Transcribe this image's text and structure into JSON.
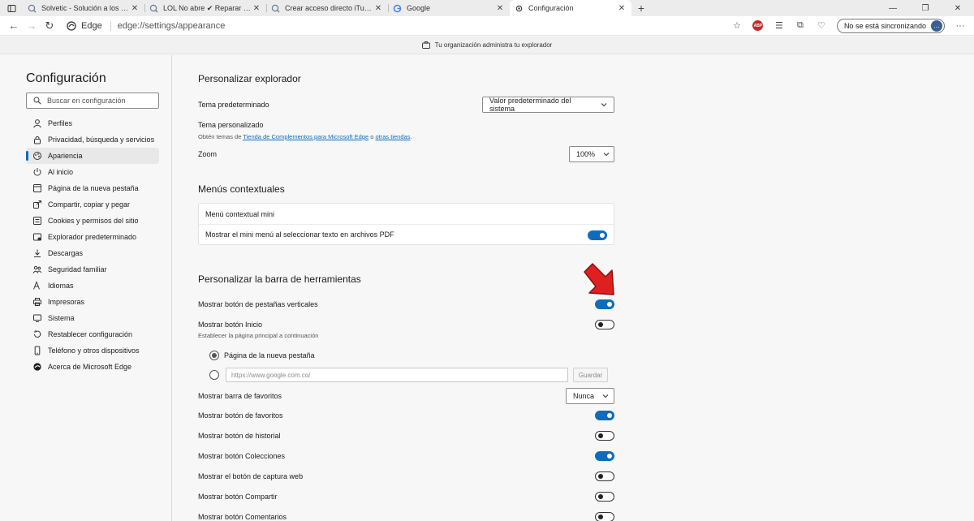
{
  "browser": {
    "tabs": [
      {
        "title": "Solvetic - Solución a los problem",
        "favicon": "solvetic-favicon"
      },
      {
        "title": "LOL No abre ✔ Reparar Leagu",
        "favicon": "solvetic-favicon"
      },
      {
        "title": "Crear acceso directo iTunes ✔",
        "favicon": "solvetic-favicon"
      },
      {
        "title": "Google",
        "favicon": "google-favicon"
      },
      {
        "title": "Configuración",
        "favicon": "gear-icon",
        "active": true
      }
    ],
    "address": {
      "site_label": "Edge",
      "url": "edge://settings/appearance"
    },
    "sync_label": "No se está sincronizando",
    "org_banner": "Tu organización administra tu explorador"
  },
  "sidebar": {
    "title": "Configuración",
    "search_placeholder": "Buscar en configuración",
    "items": [
      {
        "label": "Perfiles",
        "icon": "profile-icon"
      },
      {
        "label": "Privacidad, búsqueda y servicios",
        "icon": "lock-icon"
      },
      {
        "label": "Apariencia",
        "icon": "appearance-icon",
        "active": true
      },
      {
        "label": "Al inicio",
        "icon": "power-icon"
      },
      {
        "label": "Página de la nueva pestaña",
        "icon": "new-tab-icon"
      },
      {
        "label": "Compartir, copiar y pegar",
        "icon": "share-icon"
      },
      {
        "label": "Cookies y permisos del sitio",
        "icon": "cookie-icon"
      },
      {
        "label": "Explorador predeterminado",
        "icon": "browser-icon"
      },
      {
        "label": "Descargas",
        "icon": "download-icon"
      },
      {
        "label": "Seguridad familiar",
        "icon": "family-icon"
      },
      {
        "label": "Idiomas",
        "icon": "language-icon"
      },
      {
        "label": "Impresoras",
        "icon": "printer-icon"
      },
      {
        "label": "Sistema",
        "icon": "system-icon"
      },
      {
        "label": "Restablecer configuración",
        "icon": "reset-icon"
      },
      {
        "label": "Teléfono y otros dispositivos",
        "icon": "phone-icon"
      },
      {
        "label": "Acerca de Microsoft Edge",
        "icon": "edge-icon"
      }
    ]
  },
  "customize": {
    "title": "Personalizar explorador",
    "theme_label": "Tema predeterminado",
    "theme_value": "Valor predeterminado del sistema",
    "custom_theme_label": "Tema personalizado",
    "custom_theme_prefix": "Obtén temas de",
    "custom_theme_link1": "Tienda de Complementos para Microsoft Edge",
    "custom_theme_mid": "o",
    "custom_theme_link2": "otras tiendas",
    "custom_theme_suffix": ".",
    "zoom_label": "Zoom",
    "zoom_value": "100%"
  },
  "context_menus": {
    "title": "Menús contextuales",
    "mini_menu_header": "Menú contextual mini",
    "mini_menu_pdf_label": "Mostrar el mini menú al seleccionar texto en archivos PDF",
    "mini_menu_pdf_on": true
  },
  "toolbar_section": {
    "title": "Personalizar la barra de herramientas",
    "vertical_tabs_label": "Mostrar botón de pestañas verticales",
    "home_label": "Mostrar botón Inicio",
    "home_sub": "Establecer la página principal a continuación",
    "radio_newtab_label": "Página de la nueva pestaña",
    "url_placeholder": "https://www.google.com.co/",
    "save_label": "Guardar",
    "favorites_bar_label": "Mostrar barra de favoritos",
    "favorites_bar_value": "Nunca",
    "favorites_btn_label": "Mostrar botón de favoritos",
    "history_btn_label": "Mostrar botón de historial",
    "collections_btn_label": "Mostrar botón Colecciones",
    "webcapture_btn_label": "Mostrar el botón de captura web",
    "share_btn_label": "Mostrar botón Compartir",
    "comments_btn_label": "Mostrar botón Comentarios"
  },
  "colors": {
    "accent": "#0f6cbd",
    "arrow": "#e02020"
  }
}
